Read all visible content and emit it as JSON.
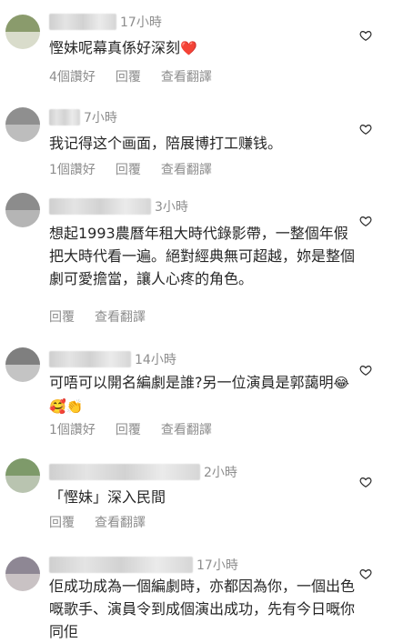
{
  "comments": [
    {
      "time": "17小時",
      "text": "慳妹呢幕真係好深刻",
      "emoji": "❤️",
      "likes": "4個讚好",
      "reply": "回覆",
      "translate": "查看翻譯",
      "avatar_colors": [
        "#8a9b6c",
        "#d9dccb"
      ]
    },
    {
      "time": "7小時",
      "text": "我记得这个画面，陪展博打工赚钱。",
      "likes": "1個讚好",
      "reply": "回覆",
      "translate": "查看翻譯",
      "avatar_colors": [
        "#8f8f8f",
        "#bdbdbd"
      ]
    },
    {
      "time": "3小時",
      "text": "想起1993農曆年租大時代錄影帶，一整個年假把大時代看一遍。絕對經典無可超越，妳是整個劇可愛擔當，讓人心疼的角色。",
      "reply": "回覆",
      "translate": "查看翻譯",
      "avatar_colors": [
        "#8c8c8c",
        "#b5b5b5"
      ]
    },
    {
      "time": "14小時",
      "text": "可唔可以開名編劇是誰?另一位演員是郭藹明",
      "emoji": "😂🥰👏",
      "likes": "1個讚好",
      "reply": "回覆",
      "translate": "查看翻譯",
      "avatar_colors": [
        "#7f7f7f",
        "#c4c4c4"
      ]
    },
    {
      "time": "2小時",
      "text": "「慳妹」深入民間",
      "reply": "回覆",
      "translate": "查看翻譯",
      "avatar_colors": [
        "#7e9a6a",
        "#b9c4b0"
      ]
    },
    {
      "time": "17小時",
      "text": "佢成功成為一個編劇時，亦都因為你，一個出色嘅歌手、演員令到成個演出成功，先有今日嘅你同佢",
      "avatar_colors": [
        "#8e8794",
        "#c9c2c4"
      ]
    }
  ],
  "icons": {
    "like": "heart-outline-icon"
  },
  "colors": {
    "text": "#262626",
    "secondary": "#8e8e8e",
    "heart": "#ed4956"
  }
}
